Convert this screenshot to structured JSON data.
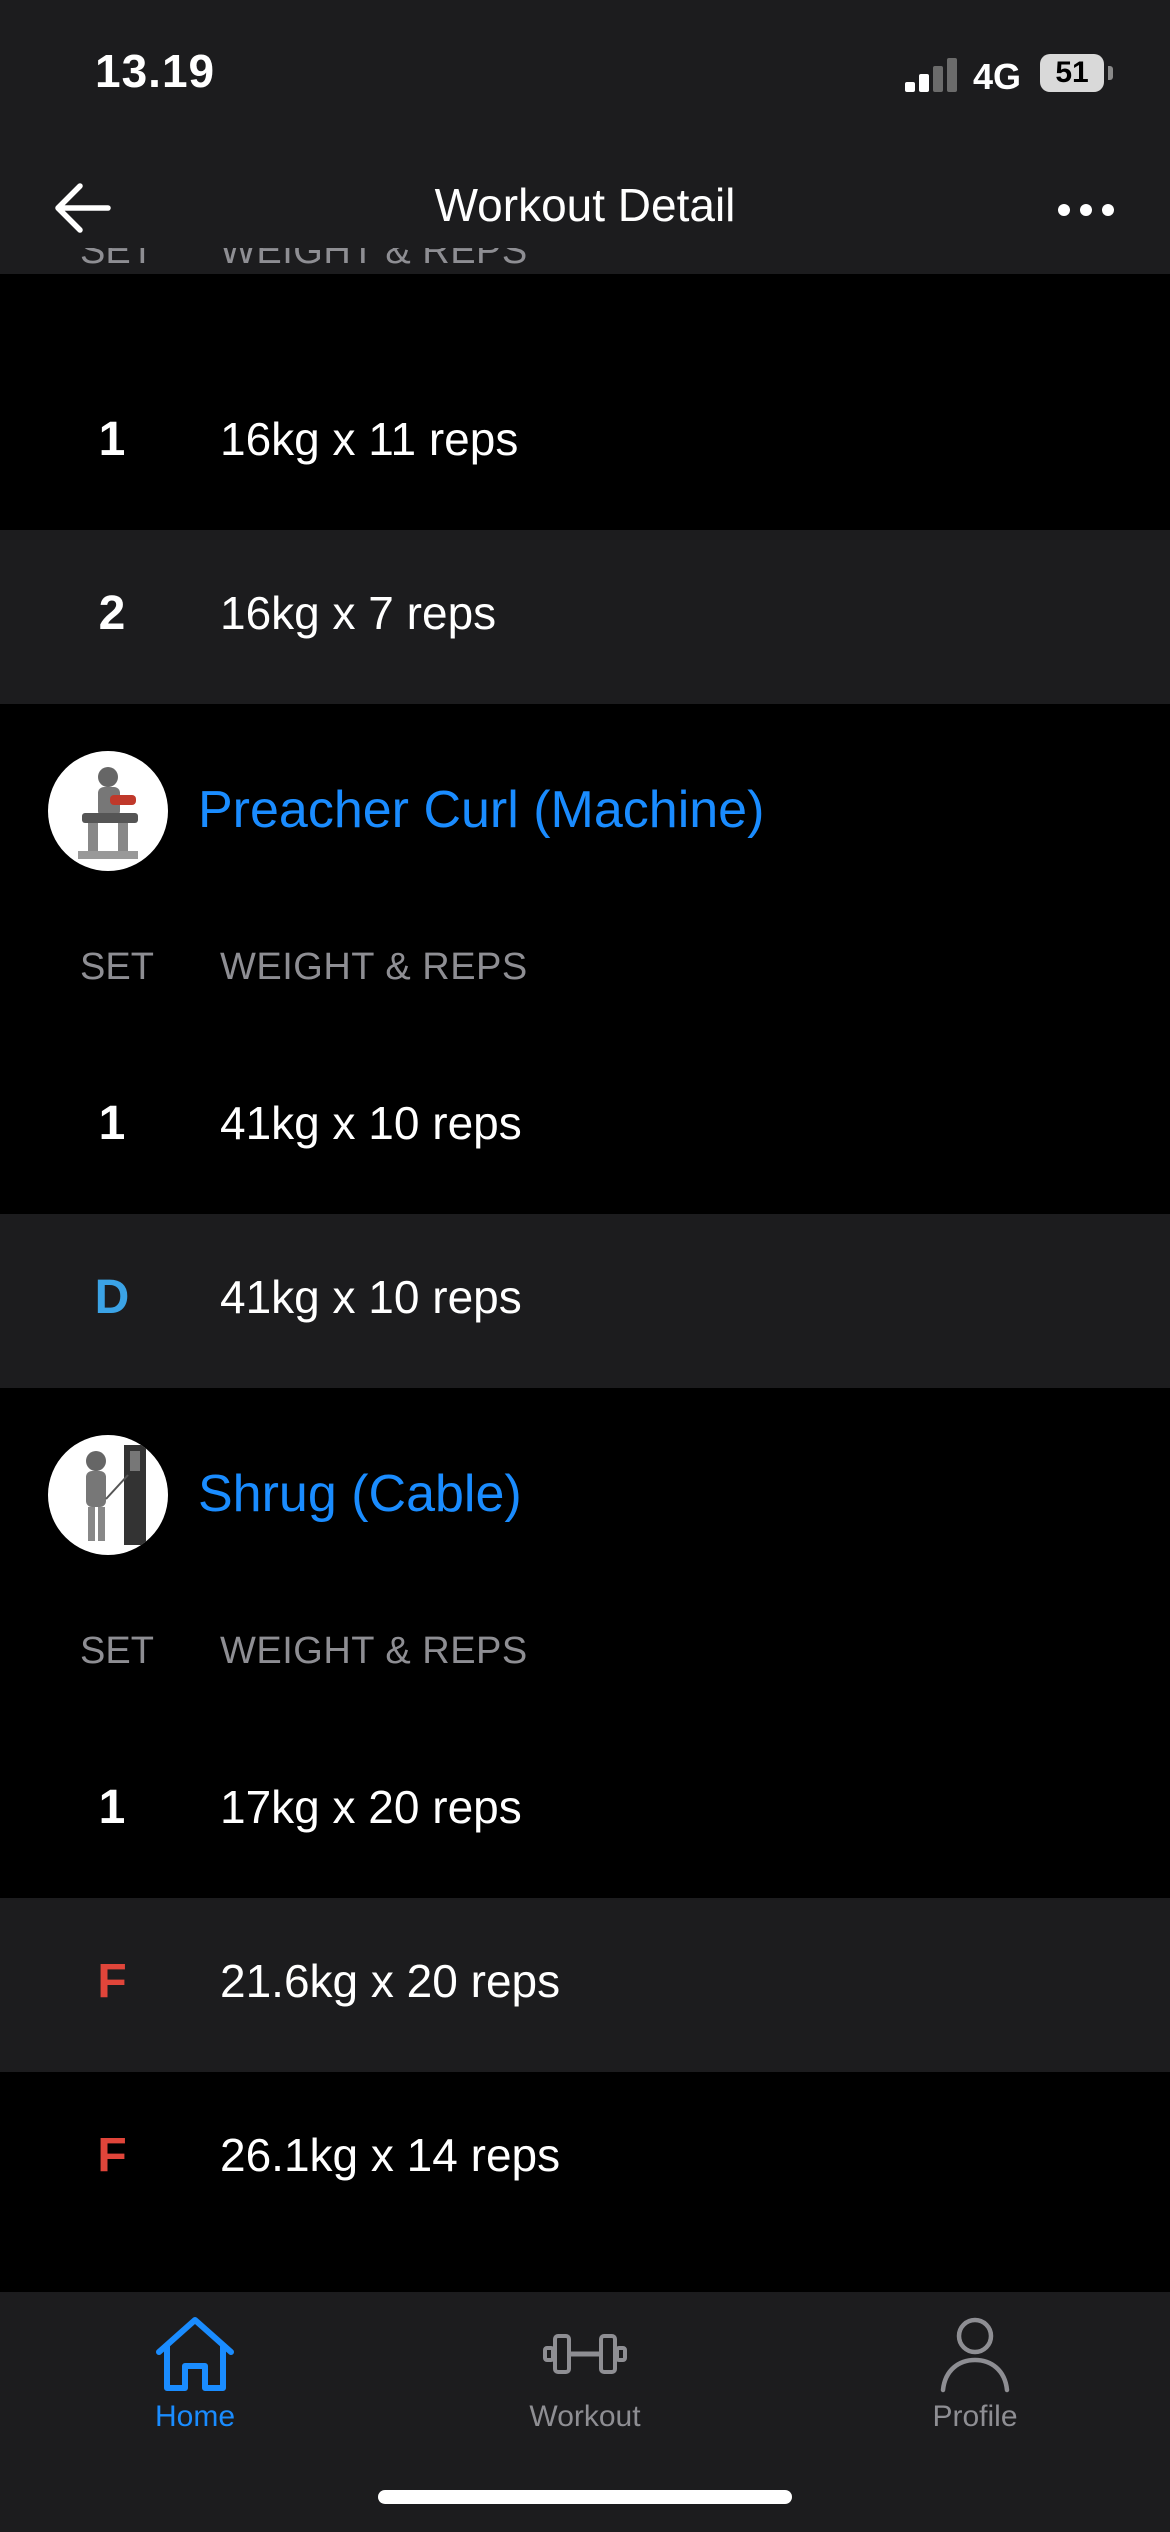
{
  "status_bar": {
    "time": "13.19",
    "network": "4G",
    "battery": "51"
  },
  "nav": {
    "title": "Workout Detail",
    "back_icon": "arrow-left-icon",
    "more_icon": "ellipsis-icon"
  },
  "table_header": {
    "set": "SET",
    "weight_reps": "WEIGHT & REPS"
  },
  "first_exercise_sets": [
    {
      "set": "1",
      "value": "16kg x 11 reps",
      "type": "normal"
    },
    {
      "set": "2",
      "value": "16kg x 7 reps",
      "type": "normal"
    }
  ],
  "exercises": [
    {
      "name": "Preacher Curl (Machine)",
      "sets": [
        {
          "set": "1",
          "value": "41kg x 10 reps",
          "type": "normal"
        },
        {
          "set": "D",
          "value": "41kg x 10 reps",
          "type": "drop"
        }
      ]
    },
    {
      "name": "Shrug (Cable)",
      "sets": [
        {
          "set": "1",
          "value": "17kg x 20 reps",
          "type": "normal"
        },
        {
          "set": "F",
          "value": "21.6kg x 20 reps",
          "type": "failure"
        },
        {
          "set": "F",
          "value": "26.1kg x 14 reps",
          "type": "failure"
        }
      ]
    }
  ],
  "tabs": [
    {
      "label": "Home",
      "icon": "home-icon",
      "active": true
    },
    {
      "label": "Workout",
      "icon": "dumbbell-icon",
      "active": false
    },
    {
      "label": "Profile",
      "icon": "profile-icon",
      "active": false
    }
  ],
  "colors": {
    "accent": "#1a8cff",
    "drop": "#3ba3e6",
    "failure": "#e0453a",
    "surface": "#1c1c1e",
    "background": "#000000"
  }
}
